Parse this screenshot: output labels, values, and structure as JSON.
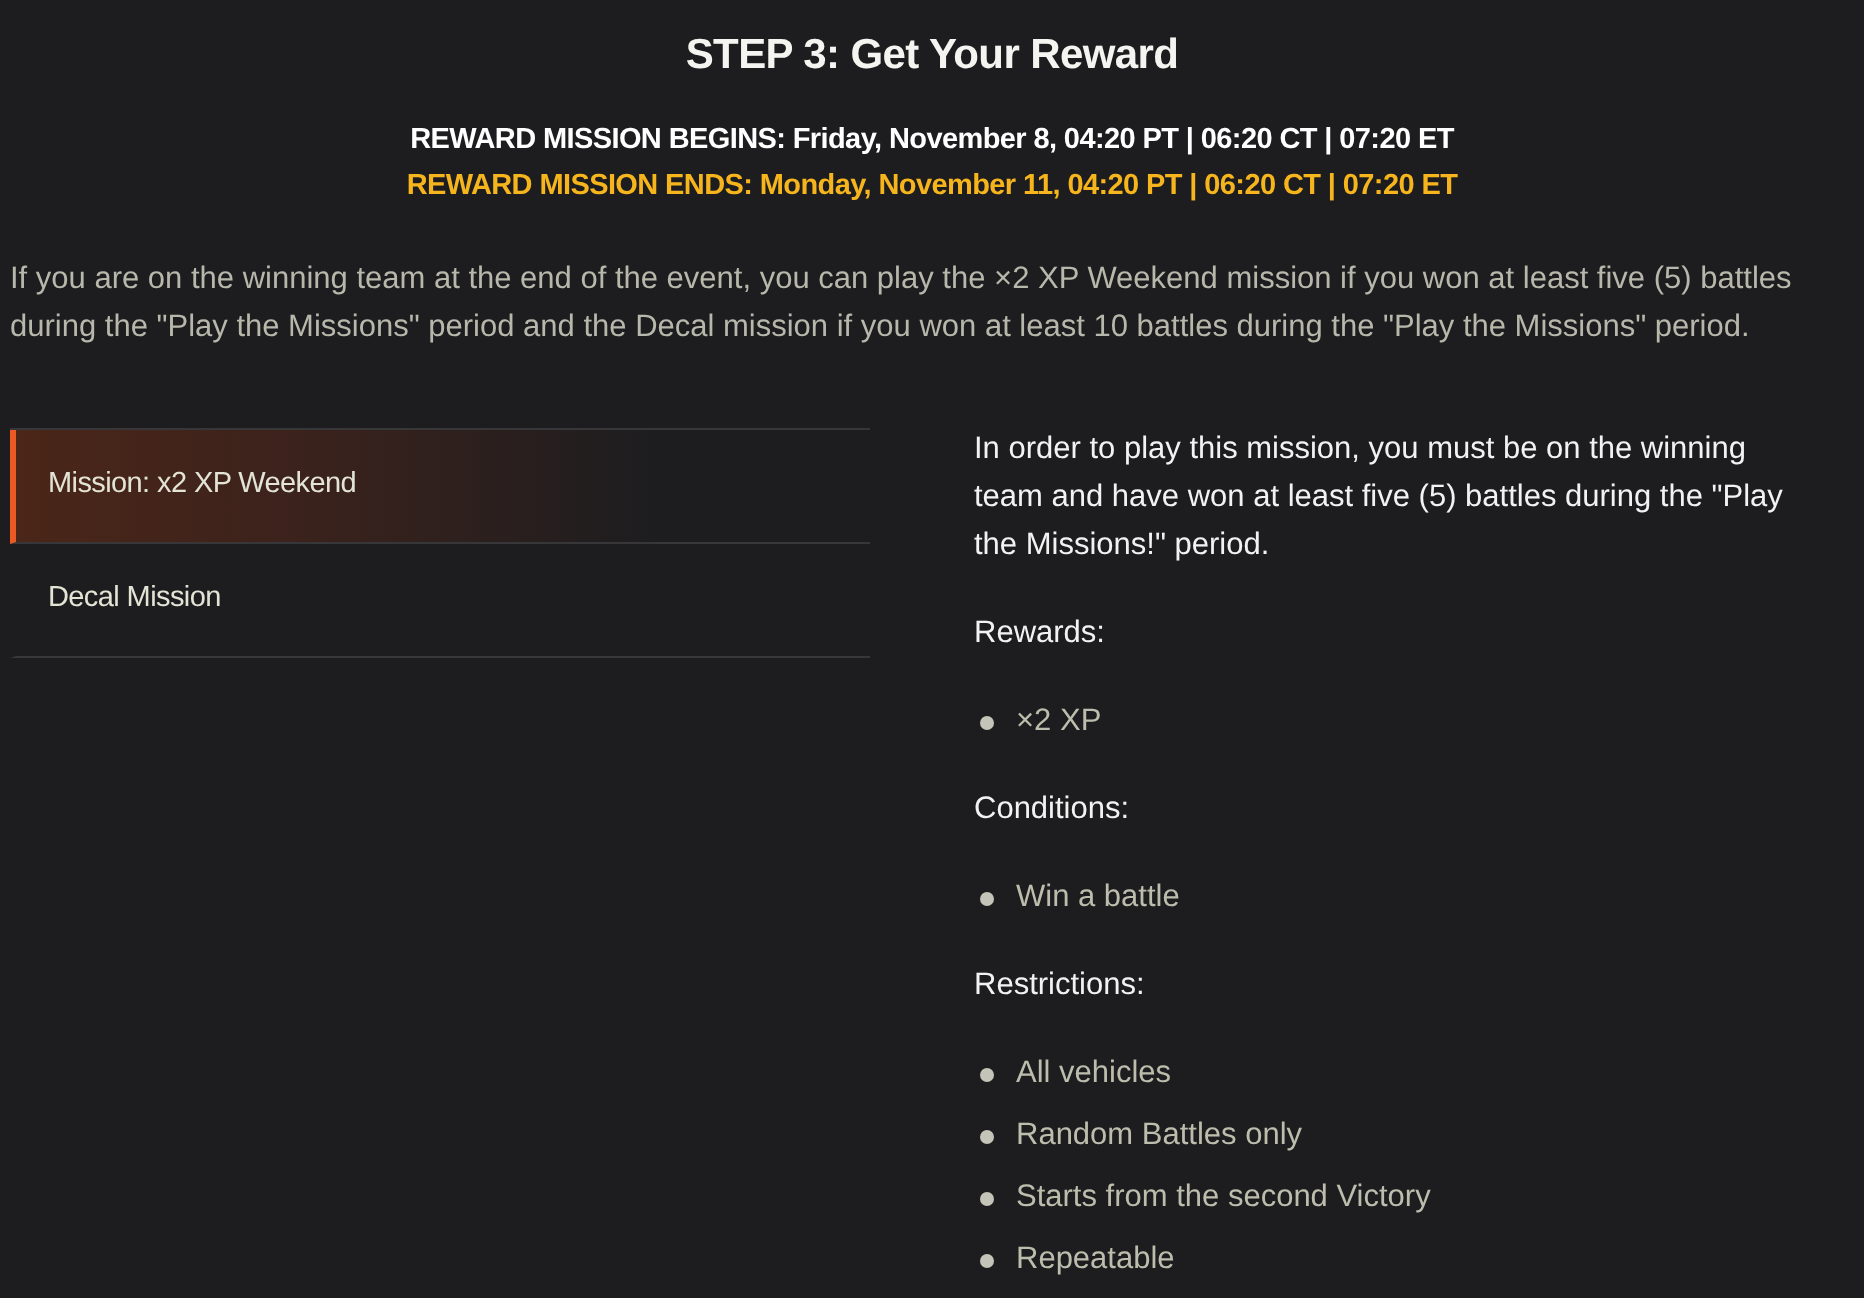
{
  "title": "STEP 3: Get Your Reward",
  "schedule": [
    {
      "text": "REWARD MISSION BEGINS: Friday, November 8, 04:20 PT | 06:20 CT | 07:20 ET",
      "color": "#ffffff"
    },
    {
      "text": "REWARD MISSION ENDS: Monday, November 11, 04:20 PT | 06:20 CT | 07:20 ET",
      "color": "#f6b51d"
    }
  ],
  "intro": "If you are on the winning team at the end of the event, you can play the ×2 XP Weekend mission if you won at least five (5) battles during the \"Play the Missions\" period and the Decal mission if you won at least 10 battles during the \"Play the Missions\" period.",
  "missions": [
    {
      "label": "Mission: x2 XP Weekend",
      "selected": true
    },
    {
      "label": "Decal Mission",
      "selected": false
    }
  ],
  "details": {
    "description": "In order to play this mission, you must be on the winning team and have won at least five (5) battles during the \"Play the Missions!\" period.",
    "sections": [
      {
        "heading": "Rewards:",
        "items": [
          "×2 XP"
        ]
      },
      {
        "heading": "Conditions:",
        "items": [
          "Win a battle"
        ]
      },
      {
        "heading": "Restrictions:",
        "items": [
          "All vehicles",
          "Random Battles only",
          "Starts from the second Victory",
          "Repeatable"
        ]
      }
    ]
  }
}
